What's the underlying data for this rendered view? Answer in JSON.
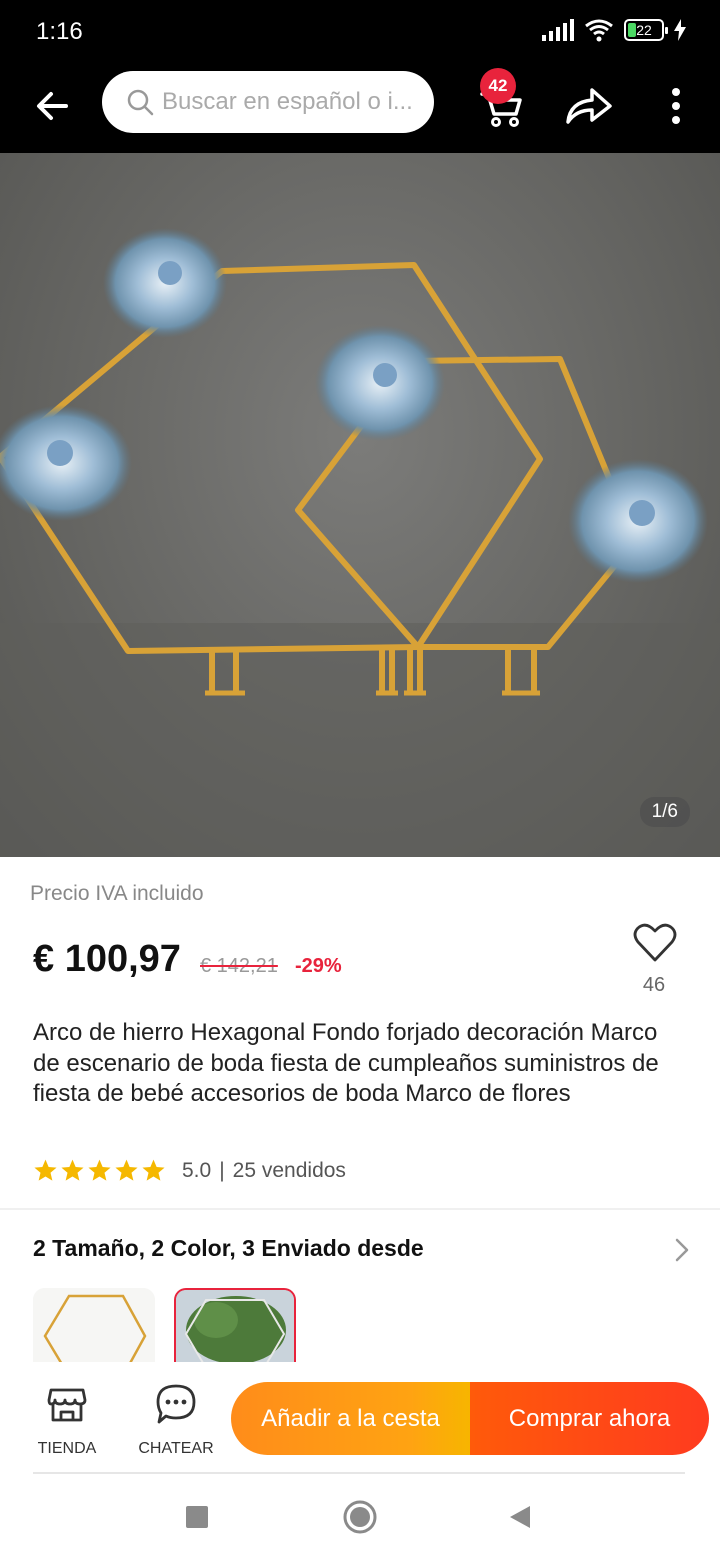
{
  "status_bar": {
    "time": "1:16",
    "battery": "22"
  },
  "nav": {
    "search_placeholder": "Buscar en español o i...",
    "cart_count": "42"
  },
  "gallery": {
    "counter": "1/6"
  },
  "price": {
    "note": "Precio IVA incluido",
    "current": "€ 100,97",
    "original": "€ 142,21",
    "discount": "-29%"
  },
  "wishlist": {
    "count": "46"
  },
  "product": {
    "title": "Arco de hierro Hexagonal Fondo forjado decoración Marco de escenario de boda fiesta de cumpleaños suministros de fiesta de bebé accesorios de boda Marco de flores"
  },
  "rating": {
    "stars": 5,
    "value": "5.0",
    "separator": "|",
    "sold": "25 vendidos"
  },
  "variants": {
    "summary": "2 Tamaño, 2 Color, 3 Enviado desde"
  },
  "bottom_bar": {
    "store_label": "TIENDA",
    "chat_label": "CHATEAR",
    "add_to_cart": "Añadir a la cesta",
    "buy_now": "Comprar ahora"
  },
  "colors": {
    "accent_red": "#e8233c",
    "cta_orange": "#ffa312",
    "cta_red": "#ff3b1f",
    "star_yellow": "#f5b800",
    "frame_gold": "#d8a237"
  }
}
